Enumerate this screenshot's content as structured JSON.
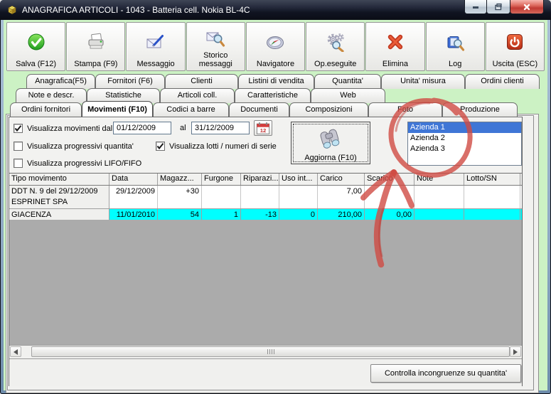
{
  "window": {
    "title": "ANAGRAFICA ARTICOLI - 1043 - Batteria cell. Nokia BL-4C"
  },
  "window_controls": {
    "minimize": "minimize",
    "restore": "restore",
    "close": "close"
  },
  "toolbar": {
    "buttons": [
      {
        "label": "Salva (F12)",
        "icon": "green-check-icon"
      },
      {
        "label": "Stampa (F9)",
        "icon": "printer-icon"
      },
      {
        "label": "Messaggio",
        "icon": "envelope-pen-icon"
      },
      {
        "label": "Storico\nmessaggi",
        "icon": "envelope-magnifier-icon"
      },
      {
        "label": "Navigatore",
        "icon": "compass-icon"
      },
      {
        "label": "Op.eseguite",
        "icon": "gears-magnifier-icon"
      },
      {
        "label": "Elimina",
        "icon": "red-x-icon"
      },
      {
        "label": "Log",
        "icon": "book-magnifier-icon"
      },
      {
        "label": "Uscita (ESC)",
        "icon": "power-icon"
      }
    ]
  },
  "tabs": {
    "rows": [
      {
        "items": [
          "Anagrafica(F5)",
          "Fornitori (F6)",
          "Clienti",
          "Listini di vendita",
          "Quantita'",
          "Unita' misura",
          "Ordini clienti"
        ]
      },
      {
        "items": [
          "Note e descr.",
          "Statistiche",
          "Articoli coll.",
          "Caratteristiche",
          "Web"
        ]
      },
      {
        "items": [
          "Ordini fornitori",
          "Movimenti (F10)",
          "Codici a barre",
          "Documenti",
          "Composizioni",
          "Foto",
          "Produzione"
        ]
      }
    ],
    "active": "Movimenti (F10)"
  },
  "filters": {
    "movimenti": {
      "checked": true,
      "label": "Visualizza movimenti dal",
      "date_from": "01/12/2009",
      "al_label": "al",
      "date_to": "31/12/2009"
    },
    "progressivi_quantita": {
      "checked": false,
      "label": "Visualizza progressivi quantita'"
    },
    "lotti": {
      "checked": true,
      "label": "Visualizza lotti /  numeri di serie"
    },
    "lifo": {
      "checked": false,
      "label": "Visualizza progressivi LIFO/FIFO"
    }
  },
  "aggiorna_button": {
    "label": "Aggiorna (F10)"
  },
  "companies": {
    "items": [
      "Azienda 1",
      "Azienda 2",
      "Azienda 3"
    ],
    "selected_index": 0
  },
  "grid": {
    "columns": [
      "Tipo movimento",
      "Data",
      "Magazz...",
      "Furgone",
      "Riparazi...",
      "Uso int...",
      "Carico",
      "Scarico",
      "Note",
      "Lotto/SN"
    ],
    "rows": [
      {
        "highlight": false,
        "cells": [
          "DDT N. 9 del 29/12/2009\nESPRINET SPA",
          "29/12/2009",
          "+30",
          "",
          "",
          "",
          "7,00",
          "",
          "",
          ""
        ]
      },
      {
        "highlight": true,
        "cells": [
          "GIACENZA",
          "11/01/2010",
          "54",
          "1",
          "-13",
          "0",
          "210,00",
          "0,00",
          "",
          ""
        ]
      }
    ]
  },
  "footer": {
    "check_button": "Controlla incongruenze su quantita'"
  },
  "colors": {
    "client_green": "#ccf2c4",
    "selection_blue": "#3f76d6",
    "row_highlight_cyan": "#00ffff",
    "annotation_red": "#cf4b44"
  }
}
